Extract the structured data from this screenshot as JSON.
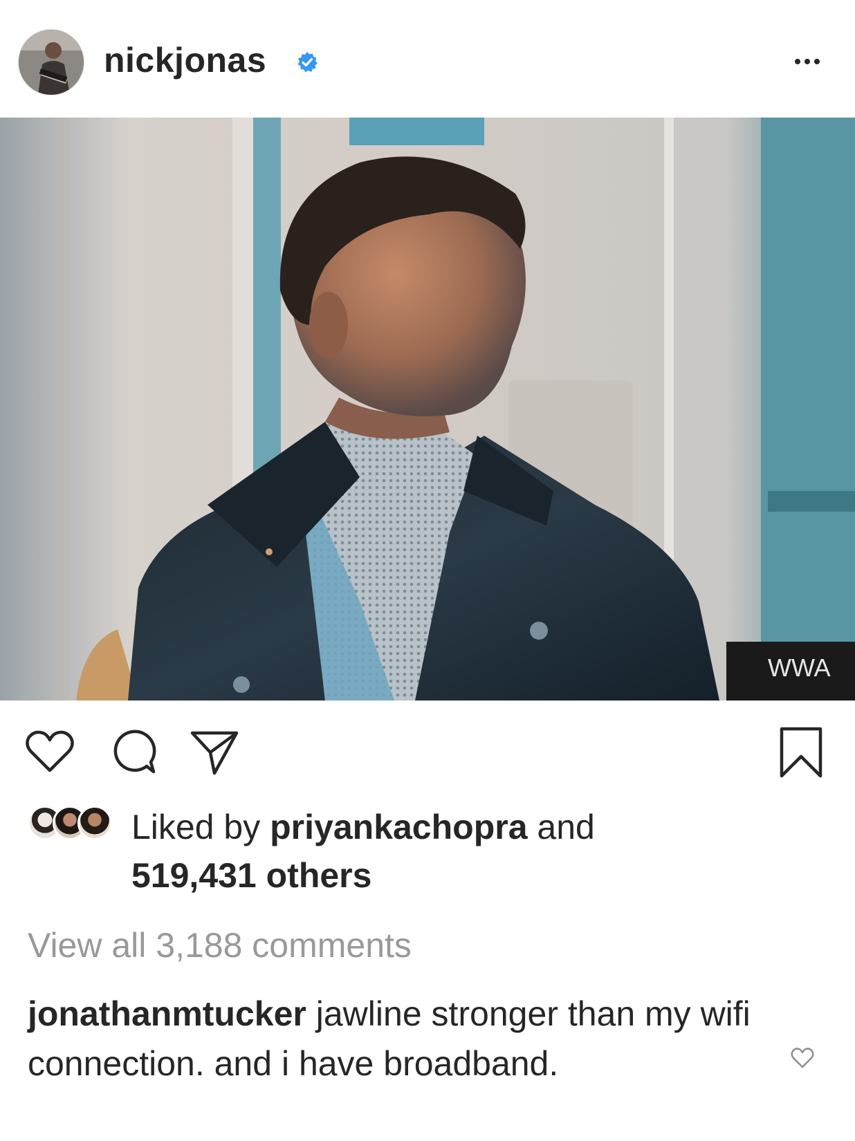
{
  "post": {
    "username": "nickjonas",
    "verified": true
  },
  "photo": {
    "alt": "",
    "sign_text": "WWA"
  },
  "actions": {
    "like_icon": "heart-outline-icon",
    "comment_icon": "comment-bubble-icon",
    "share_icon": "paper-plane-icon",
    "save_icon": "bookmark-icon"
  },
  "likes": {
    "prefix": "Liked by",
    "liker": "priyankachopra",
    "and": "and",
    "others": "519,431 others"
  },
  "comments": {
    "view_all": "View all 3,188 comments",
    "items": [
      {
        "author": "jonathanmtucker",
        "text": "jawline stronger than my wifi connection. and i have broadband."
      }
    ]
  },
  "colors": {
    "text": "#262626",
    "muted": "#999999",
    "verified_blue": "#3897f0"
  }
}
